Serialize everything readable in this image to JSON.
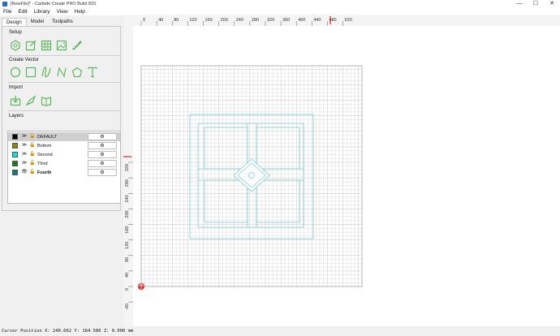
{
  "window": {
    "title": "[NewFile]* - Carbide Create PRO Build 815",
    "controls": [
      "—",
      "☐",
      "✕"
    ]
  },
  "menu": [
    "File",
    "Edit",
    "Library",
    "View",
    "Help"
  ],
  "tabs": [
    "Design",
    "Model",
    "Toolpaths"
  ],
  "sections": {
    "setup": "Setup",
    "create_vector": "Create Vector",
    "import": "Import",
    "layers": "Layers"
  },
  "layers": [
    {
      "name": "DEFAULT",
      "color": "#000000",
      "visible": false,
      "locked": true,
      "selected": true,
      "bold": false
    },
    {
      "name": "Bottom",
      "color": "#8b8b00",
      "visible": false,
      "locked": true,
      "selected": false,
      "bold": false
    },
    {
      "name": "Second",
      "color": "#00e5ee",
      "visible": false,
      "locked": true,
      "selected": false,
      "bold": false
    },
    {
      "name": "Third",
      "color": "#1f7a1f",
      "visible": false,
      "locked": true,
      "selected": false,
      "bold": false
    },
    {
      "name": "Fourth",
      "color": "#008080",
      "visible": true,
      "locked": true,
      "selected": false,
      "bold": true
    }
  ],
  "gear_label": "⚙",
  "eye_hidden": "≫",
  "eye_visible": "👁",
  "lock_glyph": "🔓",
  "ruler": {
    "x_ticks": [
      "0",
      "40",
      "80",
      "120",
      "160",
      "200",
      "240",
      "280",
      "320",
      "360",
      "400",
      "440",
      "480",
      "520"
    ],
    "y_ticks": [
      "320",
      "280",
      "240",
      "200",
      "160",
      "120",
      "80",
      "40",
      "0",
      "-40"
    ]
  },
  "cursor_marker": {
    "x": 240,
    "y": 164
  },
  "colors": {
    "accent": "#5cb85c",
    "design": "#7fcfcf",
    "grid": "#dcdcdc",
    "grid_major": "#c4c4c4",
    "marker": "#e8211b"
  },
  "status": "Cursor Position X: 240.662 Y: 164.586 Z: 0.000 mm"
}
